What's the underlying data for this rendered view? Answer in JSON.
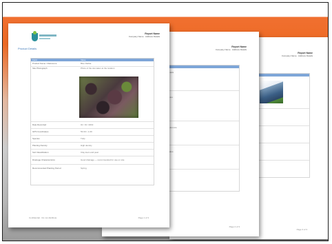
{
  "documents": [
    {
      "header_title": "Report Name",
      "header_sub": "Company Name · Address Details",
      "section_title": "Product Details",
      "table_header": [
        "Field",
        "Value"
      ],
      "rows": [
        [
          "Product Name / Reference",
          "Blue Dahlia"
        ],
        [
          "Site Photograph",
          "Photo of the site taken at the location"
        ],
        [
          "Date Recorded",
          "01 / 01 / 2019"
        ],
        [
          "GPS Coordinates",
          "53.00 / -1.00"
        ],
        [
          "Species",
          "Tulip"
        ],
        [
          "Planting Density",
          "High density"
        ],
        [
          "Soil Classification",
          "Clay loam and peat"
        ],
        [
          "Drainage Characteristics",
          "Good drainage — recommended for use on site"
        ],
        [
          "Recommended Planting Period",
          "Spring"
        ]
      ],
      "footer_left": "Confidential · Do not distribute",
      "footer_right": "Page 1 of 3"
    },
    {
      "header_title": "Report Name",
      "header_sub": "Company Name · Address Details",
      "rows": [
        [
          "Details",
          ""
        ],
        [
          "Notes",
          ""
        ],
        [
          "Reference",
          ""
        ],
        [
          "Status",
          ""
        ]
      ],
      "footer_right": "Page 2 of 3"
    },
    {
      "header_title": "Report Name",
      "header_sub": "Company Name · Address Details",
      "footer_right": "Page 3 of 3"
    }
  ]
}
